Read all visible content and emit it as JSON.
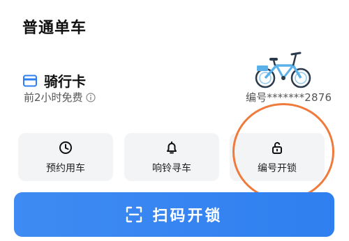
{
  "section": {
    "title": "普通单车"
  },
  "riding_card": {
    "title": "骑行卡",
    "subtitle": "前2小时免费",
    "card_icon": "card-icon",
    "info_icon": "info-icon"
  },
  "bike": {
    "illustration": "bicycle-icon",
    "number_text": "编号*******2876"
  },
  "actions": {
    "reserve": {
      "label": "预约用车",
      "icon": "clock-icon"
    },
    "ring": {
      "label": "响铃寻车",
      "icon": "bell-icon"
    },
    "unlock_by_number": {
      "label": "编号开锁",
      "icon": "unlock-icon"
    }
  },
  "scan_button": {
    "label": "扫码开锁",
    "icon": "scan-icon"
  },
  "colors": {
    "accent_blue": "#2f7ff0",
    "highlight_orange": "#f07a3c",
    "action_bg": "#f3f4f6"
  }
}
